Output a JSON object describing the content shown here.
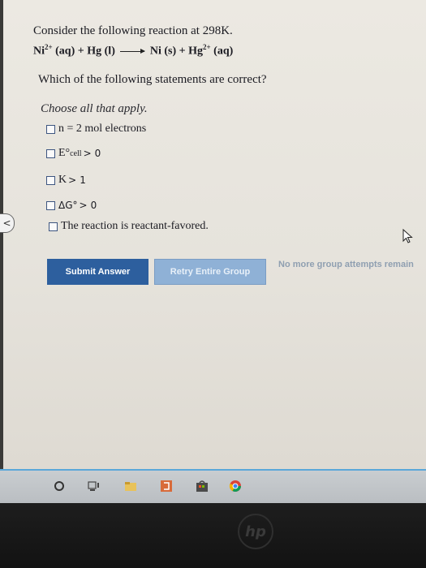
{
  "question": {
    "title": "Consider the following reaction at 298K.",
    "equation": {
      "reactant1": "Ni",
      "reactant1_charge": "2+",
      "reactant1_state": "(aq)",
      "plus1": "+",
      "reactant2": "Hg (l)",
      "product1": "Ni (s)",
      "plus2": "+",
      "product2": "Hg",
      "product2_charge": "2+",
      "product2_state": "(aq)"
    },
    "prompt": "Which of the following statements are correct?",
    "instruction": "Choose all that apply."
  },
  "choices": [
    {
      "text": "n = 2 mol electrons"
    },
    {
      "main": "E°",
      "sub": "cell",
      "op": ">",
      "val": "0"
    },
    {
      "main": "K",
      "op": ">",
      "val": "1"
    },
    {
      "main": "ΔG°",
      "op": ">",
      "val": "0"
    },
    {
      "text": "The reaction is reactant-favored."
    }
  ],
  "buttons": {
    "submit": "Submit Answer",
    "retry": "Retry Entire Group"
  },
  "status": "No more group attempts remain",
  "nav": {
    "back": "<"
  },
  "laptop": {
    "logo": "hp"
  },
  "colors": {
    "submit_bg": "#2d5f9e",
    "retry_bg": "#8fb1d6",
    "status_text": "#8f9fb1",
    "taskbar_accent": "#5aa7d9"
  },
  "taskbar_icons": [
    "cortana-circle-icon",
    "task-view-icon",
    "file-explorer-icon",
    "office-icon",
    "store-icon",
    "chrome-icon"
  ]
}
